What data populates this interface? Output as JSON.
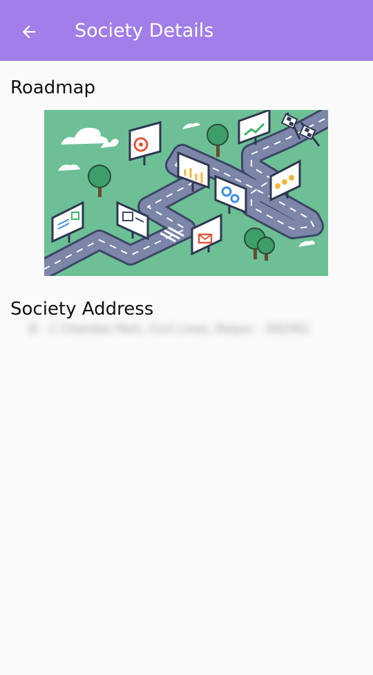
{
  "app_bar": {
    "title": "Society Details",
    "back_icon": "arrow-left-icon",
    "background_color": "#a17ee8"
  },
  "roadmap": {
    "heading": "Roadmap",
    "image_description_icon": "roadmap-illustration"
  },
  "address": {
    "heading": "Society Address",
    "value": "B - 1 Chandan Park, Civil Lines, Raipur - 492001"
  }
}
